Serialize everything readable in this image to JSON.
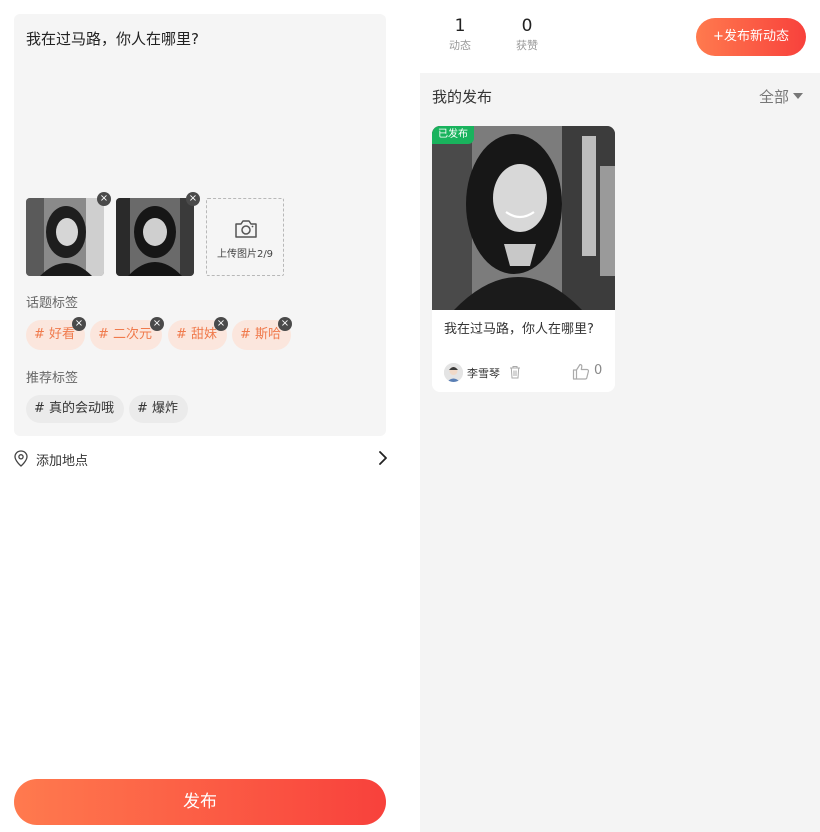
{
  "compose": {
    "text": "我在过马路，你人在哪里?",
    "upload_label": "上传图片2/9",
    "topic_tags_label": "话题标签",
    "topic_tags": [
      "# 好看",
      "# 二次元",
      "# 甜妹",
      "# 斯哈"
    ],
    "recommended_tags_label": "推荐标签",
    "recommended_tags": [
      "# 真的会动哦",
      "# 爆炸"
    ],
    "location_label": "添加地点",
    "publish_label": "发布",
    "remove_glyph": "×"
  },
  "profile": {
    "stats": [
      {
        "value": "1",
        "label": "动态"
      },
      {
        "value": "0",
        "label": "获赞"
      }
    ],
    "new_post_label": "+发布新动态"
  },
  "my_posts": {
    "title": "我的发布",
    "filter_label": "全部",
    "cards": [
      {
        "status_badge": "已发布",
        "title": "我在过马路，你人在哪里?",
        "author": "李雪琴",
        "likes": "0"
      }
    ]
  },
  "colors": {
    "accent_gradient_start": "#ff7a4e",
    "accent_gradient_end": "#f8413c",
    "tag_bg": "#fbe6dd",
    "tag_text": "#f07a4c",
    "published_badge": "#19b35d"
  },
  "icons": [
    "close-icon",
    "camera-icon",
    "location-pin-icon",
    "chevron-right-icon",
    "caret-down-icon",
    "trash-icon",
    "thumbs-up-icon"
  ]
}
